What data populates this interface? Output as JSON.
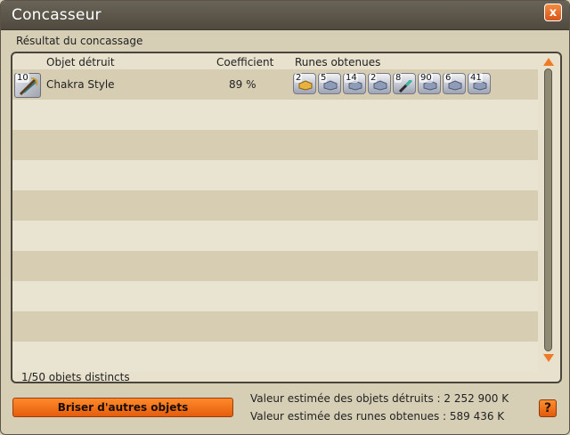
{
  "window": {
    "title": "Concasseur",
    "close_label": "x"
  },
  "section_label": "Résultat du concassage",
  "table": {
    "columns": [
      "Objet détruit",
      "Coefficient",
      "Runes obtenues"
    ],
    "rows": [
      {
        "quantity": "10",
        "name": "Chakra Style",
        "coefficient": "89 %",
        "runes": [
          {
            "quantity": "2",
            "icon": "gold-rune-icon",
            "color": "#e7b23d"
          },
          {
            "quantity": "5",
            "icon": "silver-rune-icon",
            "color": "#8f9cb8"
          },
          {
            "quantity": "14",
            "icon": "silver-rune-icon",
            "color": "#8f9cb8"
          },
          {
            "quantity": "2",
            "icon": "silver-rune-icon",
            "color": "#8f9cb8"
          },
          {
            "quantity": "8",
            "icon": "teal-rune-icon",
            "color": "#3cb7a3"
          },
          {
            "quantity": "90",
            "icon": "silver-rune-icon",
            "color": "#8f9cb8"
          },
          {
            "quantity": "6",
            "icon": "silver-rune-icon",
            "color": "#8f9cb8"
          },
          {
            "quantity": "41",
            "icon": "silver-rune-icon",
            "color": "#8f9cb8"
          }
        ]
      }
    ],
    "footer_count": "1/50 objets distincts"
  },
  "buttons": {
    "break_label": "Briser d'autres objets",
    "help_label": "?"
  },
  "estimates": {
    "destroyed": "Valeur estimée des objets détruits : 2 252 900 K",
    "runes": "Valeur estimée des runes obtenues : 589 436 K"
  },
  "colors": {
    "accent": "#f07a25",
    "panel": "#e7e1cd",
    "row_alt": "#d6cdb3"
  }
}
